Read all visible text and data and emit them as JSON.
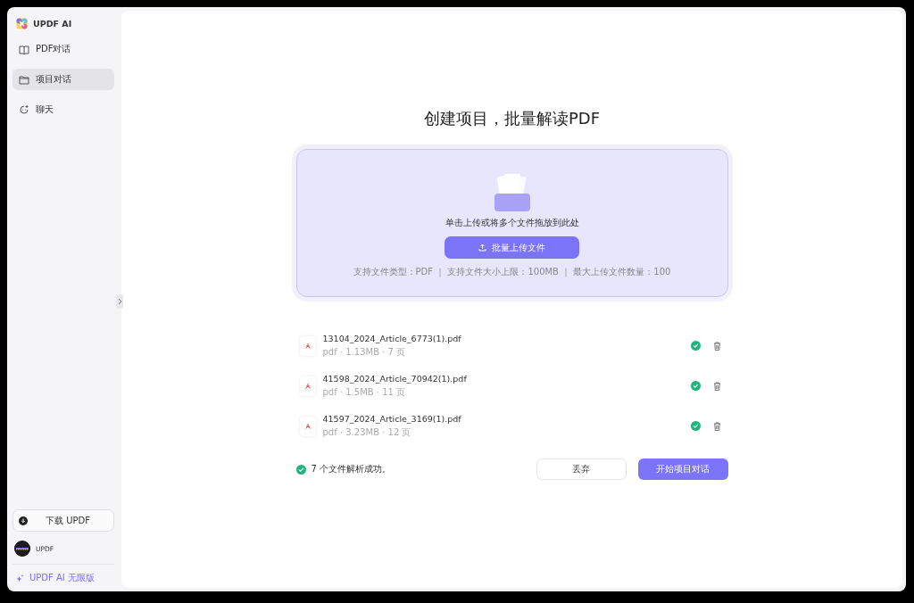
{
  "sidebar": {
    "brand": "UPDF AI",
    "items": [
      {
        "label": "PDF对话",
        "selected": false
      },
      {
        "label": "项目对话",
        "selected": true
      },
      {
        "label": "聊天",
        "selected": false
      }
    ],
    "download_button": "下载 UPDF",
    "user": {
      "name": "UPDF"
    },
    "plan": "UPDF AI 无限版"
  },
  "main": {
    "title": "创建项目，批量解读PDF",
    "dropzone": {
      "prompt": "单击上传或将多个文件拖放到此处",
      "button": "批量上传文件",
      "hint": "支持文件类型：PDF ｜ 支持文件大小上限：100MB ｜ 最大上传文件数量：100"
    },
    "files": [
      {
        "name": "13104_2024_Article_6773(1).pdf",
        "meta": "pdf · 1.13MB · 7 页",
        "parsed": true
      },
      {
        "name": "41598_2024_Article_70942(1).pdf",
        "meta": "pdf · 1.5MB · 11 页",
        "parsed": true
      },
      {
        "name": "41597_2024_Article_3169(1).pdf",
        "meta": "pdf · 3.23MB · 12 页",
        "parsed": true
      }
    ],
    "footer": {
      "message": "7 个文件解析成功。",
      "discard_button": "丢弃",
      "start_button": "开始项目对话"
    }
  }
}
